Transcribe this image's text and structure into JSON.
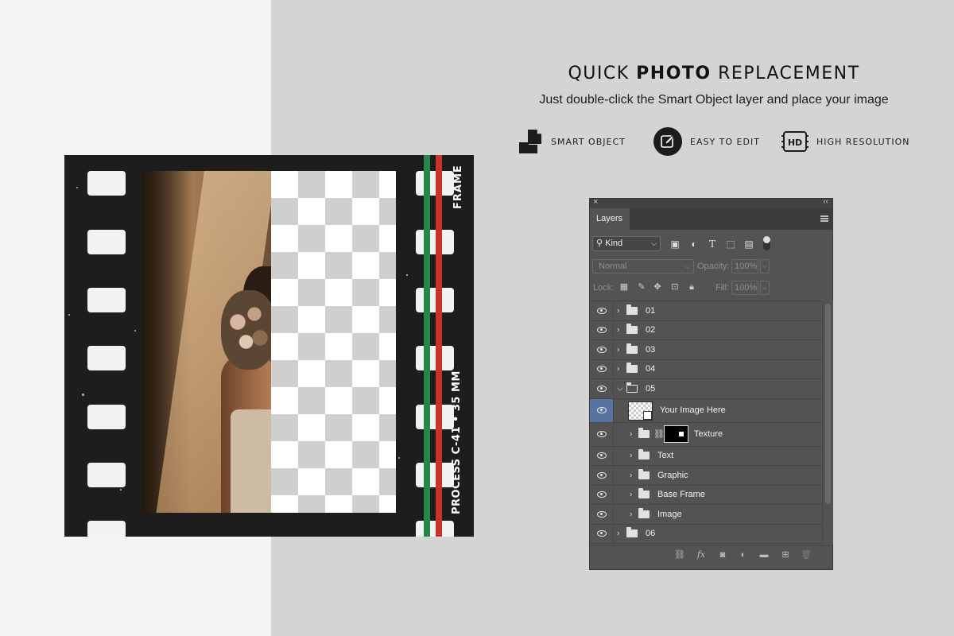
{
  "headline": {
    "prefix": "QUICK",
    "bold": "PHOTO",
    "suffix": "REPLACEMENT"
  },
  "subline": "Just double-click the Smart Object layer and place your image",
  "features": [
    {
      "label": "SMART OBJECT",
      "icon": "smart-object-icon"
    },
    {
      "label": "EASY TO EDIT",
      "icon": "edit-pencil-icon"
    },
    {
      "label": "HIGH RESOLUTION",
      "icon": "hd-icon",
      "icon_text": "HD"
    }
  ],
  "film": {
    "text_top": "FRAME",
    "text_bottom": "PROCESS C-41  •  35 MM",
    "stripe_colors": [
      "#23884a",
      "#c8332b"
    ]
  },
  "layers_panel": {
    "tab": "Layers",
    "filter_kind": "Kind",
    "blend_mode": "Normal",
    "opacity_label": "Opacity:",
    "opacity_value": "100%",
    "lock_label": "Lock:",
    "fill_label": "Fill:",
    "fill_value": "100%",
    "layers": [
      {
        "name": "01",
        "type": "group"
      },
      {
        "name": "02",
        "type": "group"
      },
      {
        "name": "03",
        "type": "group"
      },
      {
        "name": "04",
        "type": "group"
      },
      {
        "name": "05",
        "type": "group-open"
      },
      {
        "name": "Your Image Here",
        "type": "smart-object",
        "selected": true
      },
      {
        "name": "Texture",
        "type": "group-masked"
      },
      {
        "name": "Text",
        "type": "subgroup"
      },
      {
        "name": "Graphic",
        "type": "subgroup"
      },
      {
        "name": "Base Frame",
        "type": "subgroup"
      },
      {
        "name": "Image",
        "type": "subgroup"
      },
      {
        "name": "06",
        "type": "group"
      }
    ]
  }
}
